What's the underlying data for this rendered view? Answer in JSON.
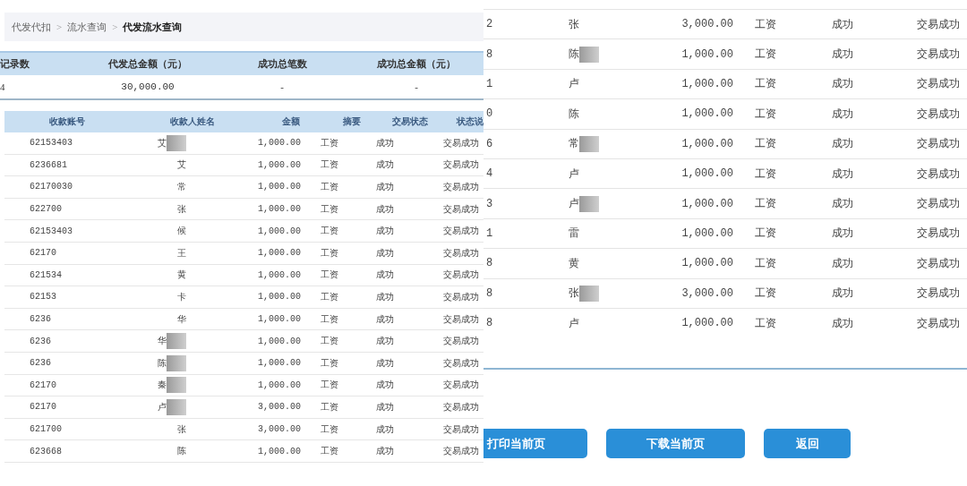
{
  "left_panel": {
    "breadcrumb": [
      {
        "label": "代发代扣",
        "current": false
      },
      {
        "label": "流水查询",
        "current": false
      },
      {
        "label": "代发流水查询",
        "current": true
      }
    ],
    "separator": ">",
    "summary": {
      "columns": [
        "记录数",
        "代发总金额（元）",
        "成功总笔数",
        "成功总金额（元）"
      ],
      "values": [
        "4",
        "30,000.00",
        "-",
        "-"
      ]
    },
    "table": {
      "columns": [
        "收款账号",
        "收款人姓名",
        "金额",
        "摘要",
        "交易状态",
        "状态说"
      ],
      "rows": [
        {
          "account": "62153403",
          "name": "艾",
          "amount": "1,000.00",
          "memo": "工资",
          "status": "成功",
          "note": "交易成功",
          "masked": true
        },
        {
          "account": "6236681",
          "name": "艾",
          "amount": "1,000.00",
          "memo": "工资",
          "status": "成功",
          "note": "交易成功",
          "masked": false
        },
        {
          "account": "62170030",
          "name": "常",
          "amount": "1,000.00",
          "memo": "工资",
          "status": "成功",
          "note": "交易成功",
          "masked": false
        },
        {
          "account": "622700",
          "name": "张",
          "amount": "1,000.00",
          "memo": "工资",
          "status": "成功",
          "note": "交易成功",
          "masked": false
        },
        {
          "account": "62153403",
          "name": "候",
          "amount": "1,000.00",
          "memo": "工资",
          "status": "成功",
          "note": "交易成功",
          "masked": false
        },
        {
          "account": "62170",
          "name": "王",
          "amount": "1,000.00",
          "memo": "工资",
          "status": "成功",
          "note": "交易成功",
          "masked": false
        },
        {
          "account": "621534",
          "name": "黄",
          "amount": "1,000.00",
          "memo": "工资",
          "status": "成功",
          "note": "交易成功",
          "masked": false
        },
        {
          "account": "62153",
          "name": "卡",
          "amount": "1,000.00",
          "memo": "工资",
          "status": "成功",
          "note": "交易成功",
          "masked": false
        },
        {
          "account": "6236",
          "name": "华",
          "amount": "1,000.00",
          "memo": "工资",
          "status": "成功",
          "note": "交易成功",
          "masked": false
        },
        {
          "account": "6236",
          "name": "华",
          "amount": "1,000.00",
          "memo": "工资",
          "status": "成功",
          "note": "交易成功",
          "masked": true
        },
        {
          "account": "6236",
          "name": "陈",
          "amount": "1,000.00",
          "memo": "工资",
          "status": "成功",
          "note": "交易成功",
          "masked": true
        },
        {
          "account": "62170",
          "name": "秦",
          "amount": "1,000.00",
          "memo": "工资",
          "status": "成功",
          "note": "交易成功",
          "masked": true
        },
        {
          "account": "62170",
          "name": "卢",
          "amount": "3,000.00",
          "memo": "工资",
          "status": "成功",
          "note": "交易成功",
          "masked": true
        },
        {
          "account": "621700",
          "name": "张",
          "amount": "3,000.00",
          "memo": "工资",
          "status": "成功",
          "note": "交易成功",
          "masked": false
        },
        {
          "account": "623668",
          "name": "陈",
          "amount": "1,000.00",
          "memo": "工资",
          "status": "成功",
          "note": "交易成功",
          "masked": false
        }
      ]
    }
  },
  "right_panel": {
    "rows": [
      {
        "account": "2",
        "name": "张",
        "amount": "3,000.00",
        "memo": "工资",
        "status": "成功",
        "note": "交易成功",
        "masked": false
      },
      {
        "account": "8",
        "name": "陈",
        "amount": "1,000.00",
        "memo": "工资",
        "status": "成功",
        "note": "交易成功",
        "masked": true
      },
      {
        "account": "1",
        "name": "卢",
        "amount": "1,000.00",
        "memo": "工资",
        "status": "成功",
        "note": "交易成功",
        "masked": false
      },
      {
        "account": "0",
        "name": "陈",
        "amount": "1,000.00",
        "memo": "工资",
        "status": "成功",
        "note": "交易成功",
        "masked": false
      },
      {
        "account": "6",
        "name": "常",
        "amount": "1,000.00",
        "memo": "工资",
        "status": "成功",
        "note": "交易成功",
        "masked": true
      },
      {
        "account": "4",
        "name": "卢",
        "amount": "1,000.00",
        "memo": "工资",
        "status": "成功",
        "note": "交易成功",
        "masked": false
      },
      {
        "account": "3",
        "name": "卢",
        "amount": "1,000.00",
        "memo": "工资",
        "status": "成功",
        "note": "交易成功",
        "masked": true
      },
      {
        "account": "1",
        "name": "雷",
        "amount": "1,000.00",
        "memo": "工资",
        "status": "成功",
        "note": "交易成功",
        "masked": false
      },
      {
        "account": "8",
        "name": "黄",
        "amount": "1,000.00",
        "memo": "工资",
        "status": "成功",
        "note": "交易成功",
        "masked": false
      },
      {
        "account": "8",
        "name": "张",
        "amount": "3,000.00",
        "memo": "工资",
        "status": "成功",
        "note": "交易成功",
        "masked": true
      },
      {
        "account": "8",
        "name": "卢",
        "amount": "1,000.00",
        "memo": "工资",
        "status": "成功",
        "note": "交易成功",
        "masked": false
      }
    ],
    "buttons": [
      "打印当前页",
      "下载当前页",
      "返回"
    ]
  }
}
